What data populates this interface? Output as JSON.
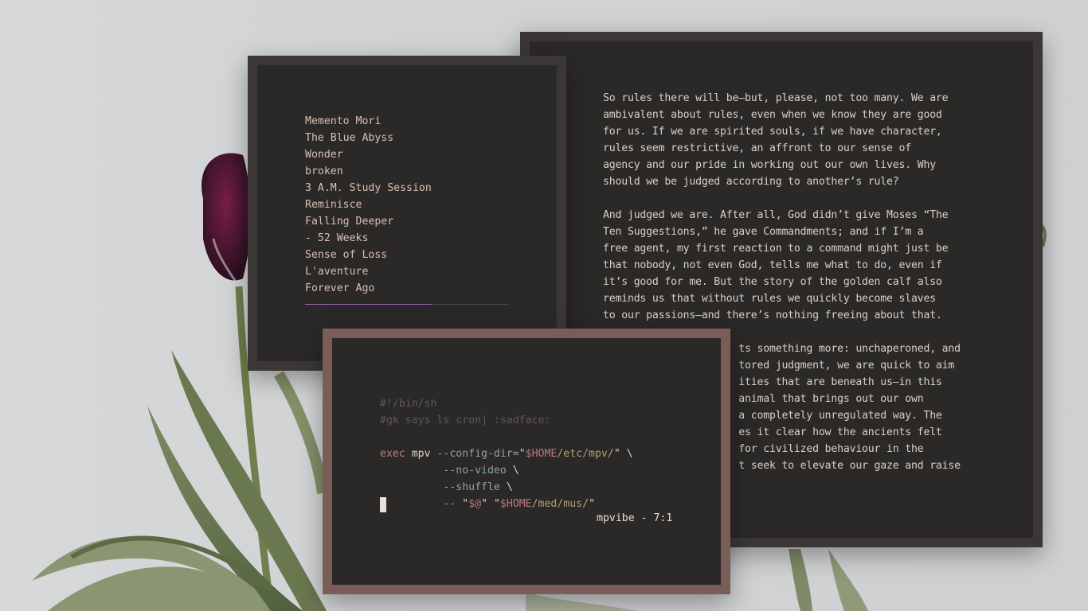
{
  "reader": {
    "paragraphs": [
      "So rules there will be—but, please, not too many. We are\nambivalent about rules, even when we know they are good\nfor us. If we are spirited souls, if we have character,\nrules seem restrictive, an affront to our sense of\nagency and our pride in working out our own lives. Why\nshould we be judged according to another’s rule?",
      "And judged we are. After all, God didn’t give Moses “The\nTen Suggestions,” he gave Commandments; and if I’m a\nfree agent, my first reaction to a command might just be\nthat nobody, not even God, tells me what to do, even if\nit’s good for me. But the story of the golden calf also\nreminds us that without rules we quickly become slaves\nto our passions—and there’s nothing freeing about that.",
      "                      ts something more: unchaperoned, and\n                      tored judgment, we are quick to aim\n                      ities that are beneath us—in this\n                      animal that brings out our own\n                      a completely unregulated way. The\n                      es it clear how the ancients felt\n                      for civilized behaviour in the\n                      t seek to elevate our gaze and raise"
    ]
  },
  "playlist": {
    "tracks": [
      "Memento Mori",
      "The Blue Abyss",
      "Wonder",
      "broken",
      "3 A.M. Study Session",
      "Reminisce",
      "Falling Deeper",
      "- 52 Weeks",
      "Sense of Loss",
      "L'aventure",
      "Forever Ago"
    ],
    "progress": 0.62,
    "progress_color": "#a65fb2"
  },
  "editor": {
    "line1": "#!/bin/sh",
    "line2": "#gk says ls cronj :sadface:",
    "exec_kw": "exec",
    "mpv": " mpv ",
    "config_flag": "--config-dir=",
    "config_q1": "\"",
    "config_var": "$HOME",
    "config_path": "/etc/mpv/",
    "config_q2": "\"",
    "config_bs": " \\",
    "indent": "          ",
    "novideo": "--no-video",
    "novideo_bs": " \\",
    "shuffle": "--shuffle",
    "shuffle_bs": " \\",
    "dashes": "-- ",
    "args_q1": "\"",
    "args_var": "$@",
    "args_q2": "\" \"",
    "args_home": "$HOME",
    "args_path": "/med/mus/",
    "args_q3": "\"",
    "statusline": "mpvibe - 7:1"
  },
  "colors": {
    "window_bg": "#2b2928",
    "window_border": "#3a3736",
    "editor_border": "#7a5d59",
    "text": "#d8d0c6"
  }
}
